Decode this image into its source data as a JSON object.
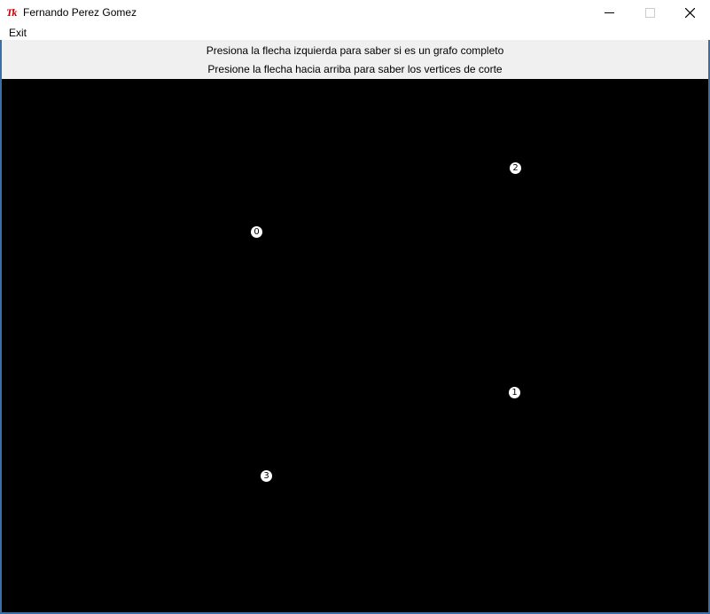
{
  "window": {
    "title": "Fernando Perez Gomez",
    "icon": "Tk",
    "controls": [
      "minimize-icon",
      "maximize-icon",
      "close-icon"
    ]
  },
  "menu": {
    "exit_label": "Exit"
  },
  "instructions": {
    "line1": "Presiona la flecha izquierda para saber si es un grafo completo",
    "line2": "Presione la flecha hacia arriba para saber los vertices de corte"
  },
  "graph": {
    "nodes": [
      {
        "label": "0"
      },
      {
        "label": "1"
      },
      {
        "label": "2"
      },
      {
        "label": "3"
      }
    ]
  },
  "colors": {
    "canvas_background": "#000000",
    "node_fill": "#ffffff",
    "panel_background": "#f0f0f0",
    "icon_red": "#cc0000"
  }
}
